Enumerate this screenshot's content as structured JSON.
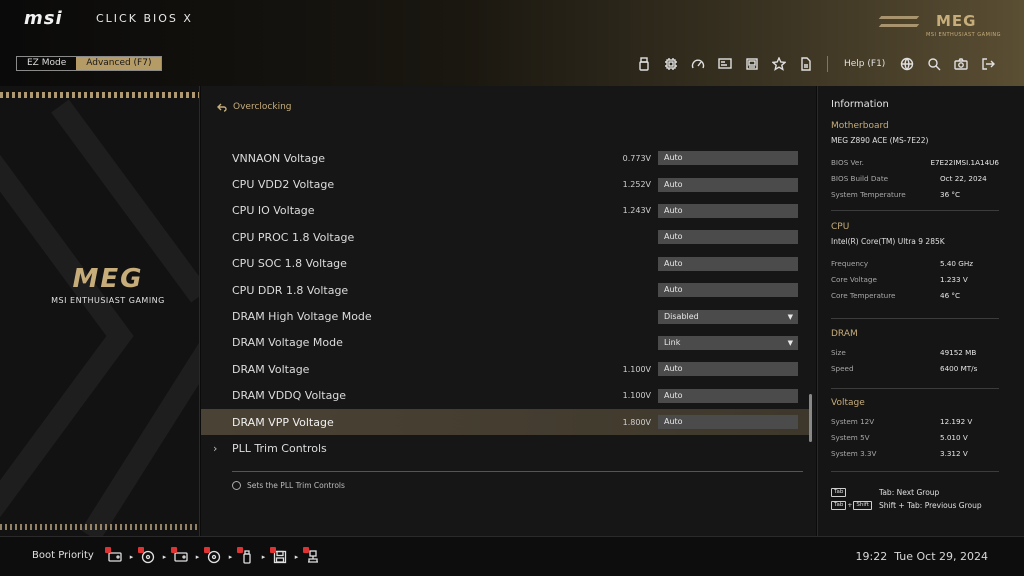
{
  "header": {
    "brand": "msi",
    "product": "CLICK BIOS X",
    "modes": [
      {
        "label": "EZ Mode",
        "active": false
      },
      {
        "label": "Advanced (F7)",
        "active": true
      }
    ],
    "toolbar_icons": [
      "usb-drive-icon",
      "cpu-chip-icon",
      "speedometer-icon",
      "hardware-monitor-icon",
      "memory-icon",
      "star-icon",
      "document-icon"
    ],
    "help_label": "Help (F1)",
    "right_icons": [
      "globe-icon",
      "search-icon",
      "camera-icon",
      "exit-icon"
    ],
    "meg_logo": "MEG",
    "meg_caption": "MSI ENTHUSIAST GAMING"
  },
  "left": {
    "logo": "MEG",
    "caption": "MSI ENTHUSIAST GAMING"
  },
  "main": {
    "breadcrumb": "Overclocking",
    "rows": [
      {
        "label": "VNNAON Voltage",
        "value": "0.773V",
        "setting": "Auto",
        "dropdown": false
      },
      {
        "label": "CPU VDD2 Voltage",
        "value": "1.252V",
        "setting": "Auto",
        "dropdown": false
      },
      {
        "label": "CPU IO Voltage",
        "value": "1.243V",
        "setting": "Auto",
        "dropdown": false
      },
      {
        "label": "CPU PROC 1.8 Voltage",
        "value": "",
        "setting": "Auto",
        "dropdown": false
      },
      {
        "label": "CPU SOC 1.8 Voltage",
        "value": "",
        "setting": "Auto",
        "dropdown": false
      },
      {
        "label": "CPU DDR 1.8 Voltage",
        "value": "",
        "setting": "Auto",
        "dropdown": false
      },
      {
        "label": "DRAM High Voltage Mode",
        "value": "",
        "setting": "Disabled",
        "dropdown": true
      },
      {
        "label": "DRAM Voltage Mode",
        "value": "",
        "setting": "Link",
        "dropdown": true
      },
      {
        "label": "DRAM Voltage",
        "value": "1.100V",
        "setting": "Auto",
        "dropdown": false
      },
      {
        "label": "DRAM VDDQ Voltage",
        "value": "1.100V",
        "setting": "Auto",
        "dropdown": false
      },
      {
        "label": "DRAM VPP Voltage",
        "value": "1.800V",
        "setting": "Auto",
        "dropdown": false,
        "selected": true
      }
    ],
    "submenu": {
      "label": "PLL Trim Controls"
    },
    "hint": "Sets the PLL Trim Controls"
  },
  "info": {
    "title": "Information",
    "motherboard": {
      "heading": "Motherboard",
      "model": "MEG Z890 ACE (MS-7E22)",
      "items": [
        {
          "k": "BIOS Ver.",
          "v": "E7E22IMSI.1A14U6"
        },
        {
          "k": "BIOS Build Date",
          "v": "Oct 22, 2024"
        },
        {
          "k": "System Temperature",
          "v": "36 °C"
        }
      ]
    },
    "cpu": {
      "heading": "CPU",
      "model": "Intel(R) Core(TM) Ultra 9 285K",
      "items": [
        {
          "k": "Frequency",
          "v": "5.40 GHz"
        },
        {
          "k": "Core Voltage",
          "v": "1.233 V"
        },
        {
          "k": "Core Temperature",
          "v": "46 °C"
        }
      ]
    },
    "dram": {
      "heading": "DRAM",
      "items": [
        {
          "k": "Size",
          "v": "49152 MB"
        },
        {
          "k": "Speed",
          "v": "6400 MT/s"
        }
      ]
    },
    "voltage": {
      "heading": "Voltage",
      "items": [
        {
          "k": "System 12V",
          "v": "12.192 V"
        },
        {
          "k": "System 5V",
          "v": "5.010 V"
        },
        {
          "k": "System 3.3V",
          "v": "3.312 V"
        }
      ]
    },
    "keyhints": [
      {
        "keys": [
          "Tab"
        ],
        "text": "Tab: Next Group"
      },
      {
        "keys": [
          "Tab",
          "+",
          "Shift"
        ],
        "text": "Shift + Tab: Previous Group"
      }
    ]
  },
  "footer": {
    "boot_label": "Boot Priority",
    "boot_devices": [
      "hdd-icon",
      "optical-disc-icon",
      "hdd-icon",
      "optical-disc-icon",
      "usb-drive-icon",
      "floppy-icon",
      "network-icon"
    ],
    "time": "19:22",
    "date": "Tue Oct 29, 2024"
  },
  "colors": {
    "accent_gold": "#c7ad7a",
    "mode_active": "#b59b66",
    "field_bg": "#4b4b4b",
    "selected_row": "#4a4234"
  }
}
